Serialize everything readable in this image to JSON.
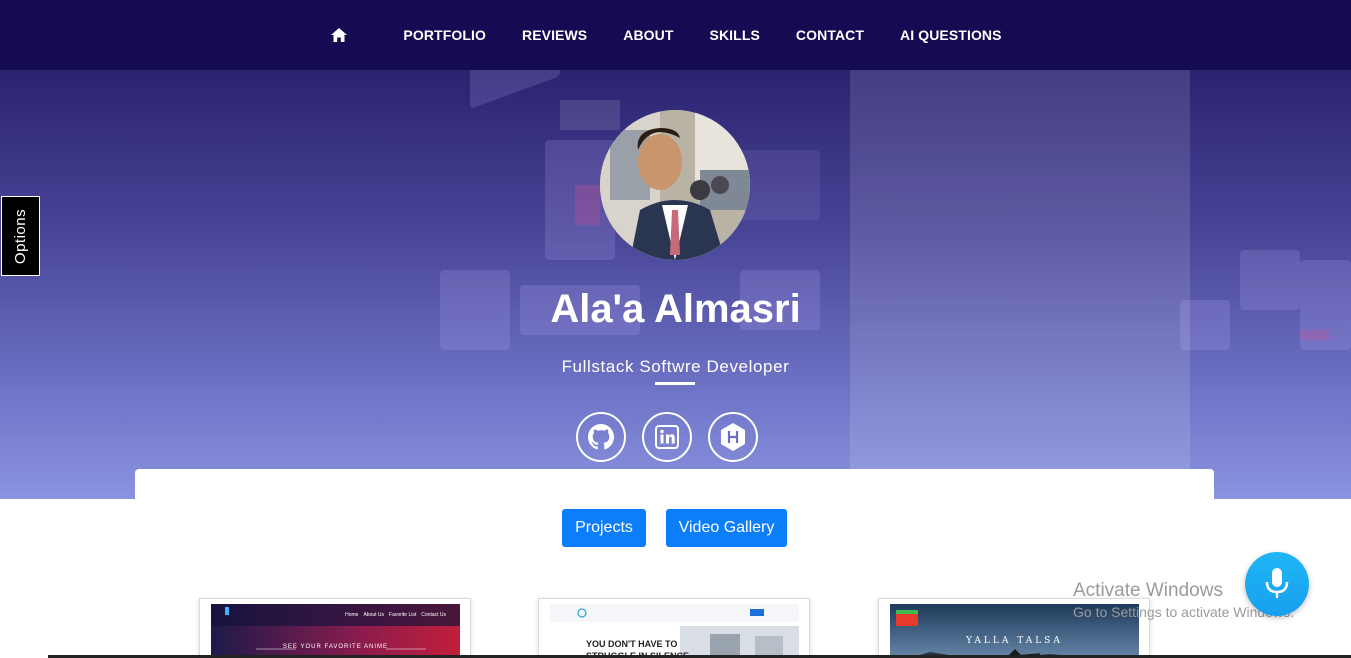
{
  "nav": {
    "home_icon": "home-icon",
    "items": [
      "PORTFOLIO",
      "REVIEWS",
      "ABOUT",
      "SKILLS",
      "CONTACT",
      "AI QUESTIONS"
    ]
  },
  "options_tab": {
    "label": "Options"
  },
  "hero": {
    "name": "Ala'a Almasri",
    "title": "Fullstack Softwre Developer",
    "socials": [
      {
        "icon": "github-icon"
      },
      {
        "icon": "linkedin-icon"
      },
      {
        "icon": "hackerrank-icon"
      }
    ]
  },
  "tabs": {
    "projects_label": "Projects",
    "video_label": "Video Gallery"
  },
  "projects": [
    {
      "name": "anime-site",
      "tagline": "SEE YOUR FAVORITE ANIME",
      "nav_links": [
        "Home",
        "About Us",
        "Favorite List",
        "Contact Us"
      ]
    },
    {
      "name": "wellness-site",
      "headline_1": "YOU DON'T HAVE TO",
      "headline_2": "STRUGGLE IN SILENCE"
    },
    {
      "name": "yalla-talsa-site",
      "headline": "YALLA TALSA"
    }
  ],
  "watermark": {
    "line1": "Activate Windows",
    "line2": "Go to Settings to activate Windows."
  },
  "mic": {
    "icon": "microphone-icon"
  },
  "colors": {
    "nav_bg": "#150b52",
    "button_blue": "#0d7ef9",
    "mic_blue": "#1fb6f5"
  }
}
